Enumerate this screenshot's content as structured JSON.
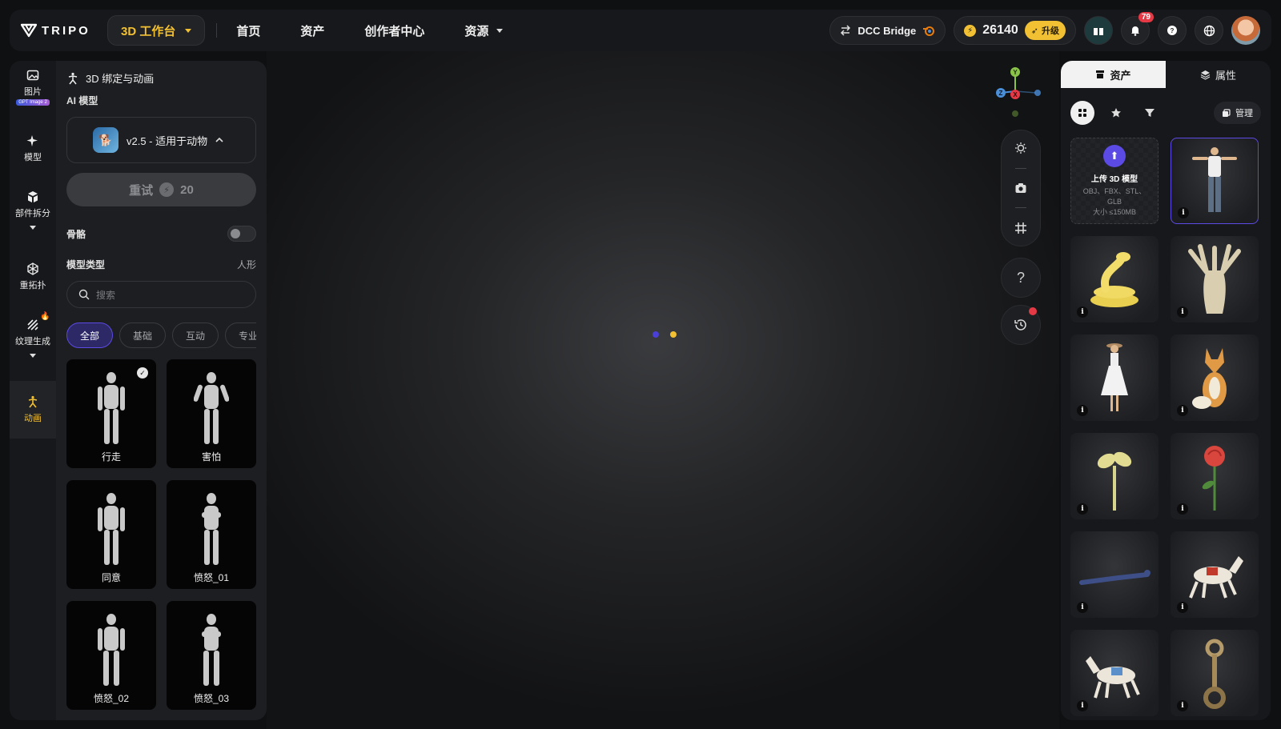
{
  "header": {
    "logo_text": "TRIPO",
    "workbench_label": "3D 工作台",
    "nav": [
      {
        "label": "首页"
      },
      {
        "label": "资产"
      },
      {
        "label": "创作者中心"
      },
      {
        "label": "资源"
      }
    ],
    "dcc_bridge_label": "DCC Bridge",
    "credits": "26140",
    "upgrade_label": "升级",
    "notification_count": "79"
  },
  "rail": {
    "items": [
      {
        "label": "图片",
        "tag": "GPT Image 2",
        "icon": "image-icon"
      },
      {
        "label": "模型",
        "icon": "sparkle-icon"
      },
      {
        "label": "部件拆分",
        "icon": "cube-split-icon"
      },
      {
        "label": "重拓扑",
        "icon": "topology-icon"
      },
      {
        "label": "纹理生成",
        "icon": "texture-icon"
      },
      {
        "label": "动画",
        "icon": "animation-icon"
      }
    ],
    "active": "动画"
  },
  "panel": {
    "title": "3D 绑定与动画",
    "ai_model_label": "AI 模型",
    "model_option": "v2.5 - 适用于动物",
    "retry_label": "重试",
    "retry_cost": "20",
    "skeleton_label": "骨骼",
    "skeleton_on": false,
    "model_type_label": "模型类型",
    "model_type_value": "人形",
    "search_placeholder": "搜索",
    "chips": [
      {
        "label": "全部",
        "active": true
      },
      {
        "label": "基础",
        "active": false
      },
      {
        "label": "互动",
        "active": false
      },
      {
        "label": "专业",
        "active": false
      }
    ],
    "animations": [
      {
        "name": "行走",
        "selected": true
      },
      {
        "name": "害怕",
        "selected": false
      },
      {
        "name": "同意",
        "selected": false
      },
      {
        "name": "愤怒_01",
        "selected": false
      },
      {
        "name": "愤怒_02",
        "selected": false
      },
      {
        "name": "愤怒_03",
        "selected": false
      }
    ]
  },
  "viewport": {
    "axis_labels": {
      "y": "Y",
      "z": "Z",
      "x": "X"
    },
    "help_label": "?"
  },
  "assets": {
    "tabs": [
      {
        "label": "资产",
        "active": true
      },
      {
        "label": "属性",
        "active": false
      }
    ],
    "manage_label": "管理",
    "upload": {
      "title": "上传 3D 模型",
      "formats": "OBJ、FBX、STL、GLB",
      "size_limit": "大小 ≤150MB"
    },
    "items": [
      {
        "name": "t-pose-character"
      },
      {
        "name": "yellow-snake"
      },
      {
        "name": "tree-creature"
      },
      {
        "name": "girl-in-dress"
      },
      {
        "name": "fox"
      },
      {
        "name": "sprout"
      },
      {
        "name": "rose"
      },
      {
        "name": "lying-figure"
      },
      {
        "name": "carousel-horse"
      },
      {
        "name": "carousel-horse-2"
      },
      {
        "name": "piston-rod"
      }
    ],
    "info_glyph": "i"
  },
  "colors": {
    "accent_yellow": "#f2c133",
    "accent_purple": "#5b4ae3",
    "badge_red": "#e53945"
  }
}
